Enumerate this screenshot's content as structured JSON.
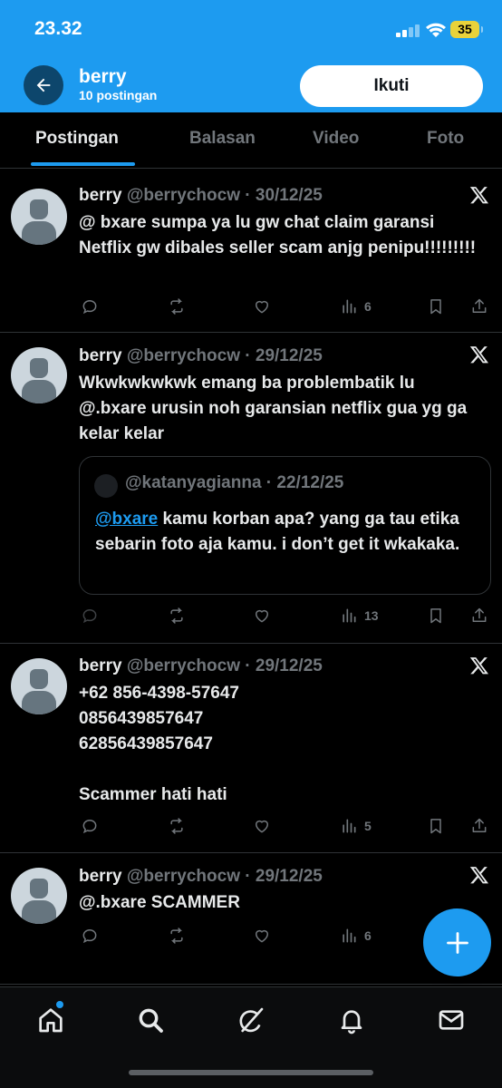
{
  "status_bar": {
    "time": "23.32",
    "battery": "35"
  },
  "header": {
    "name": "berry",
    "post_count": "10 postingan",
    "follow_label": "Ikuti"
  },
  "tabs": [
    {
      "label": "Postingan",
      "active": true
    },
    {
      "label": "Balasan",
      "active": false
    },
    {
      "label": "Video",
      "active": false
    },
    {
      "label": "Foto",
      "active": false
    }
  ],
  "posts": [
    {
      "name": "berry",
      "meta": "@berrychocw · 30/12/25",
      "text": "@ bxare sumpa ya lu gw chat claim garansi Netflix gw dibales seller scam anjg penipu!!!!!!!!!",
      "views": "6"
    },
    {
      "name": "berry",
      "meta": "@berrychocw · 29/12/25",
      "text": "Wkwkwkwkwk emang ba problembatik lu @.bxare urusin noh garansian netflix gua yg ga kelar kelar",
      "quote": {
        "meta": "@katanyagianna · 22/12/25",
        "mention": "@bxare",
        "text": " kamu korban apa? yang ga tau etika sebarin foto aja kamu. i don’t get it wkakaka."
      },
      "views": "13"
    },
    {
      "name": "berry",
      "meta": "@berrychocw · 29/12/25",
      "text": "+62 856-4398-57647\n0856439857647\n62856439857647\n\nScammer hati hati",
      "views": "5"
    },
    {
      "name": "berry",
      "meta": "@berrychocw · 29/12/25",
      "text": "@.bxare SCAMMER",
      "views": "6"
    }
  ],
  "colors": {
    "accent": "#1d9bf0",
    "background": "#000000",
    "muted": "#71767b",
    "battery": "#e9d23a"
  },
  "icons": {
    "nav": [
      "home-icon",
      "search-icon",
      "grok-icon",
      "notifications-icon",
      "messages-icon"
    ],
    "fab": "compose-plus-icon"
  }
}
